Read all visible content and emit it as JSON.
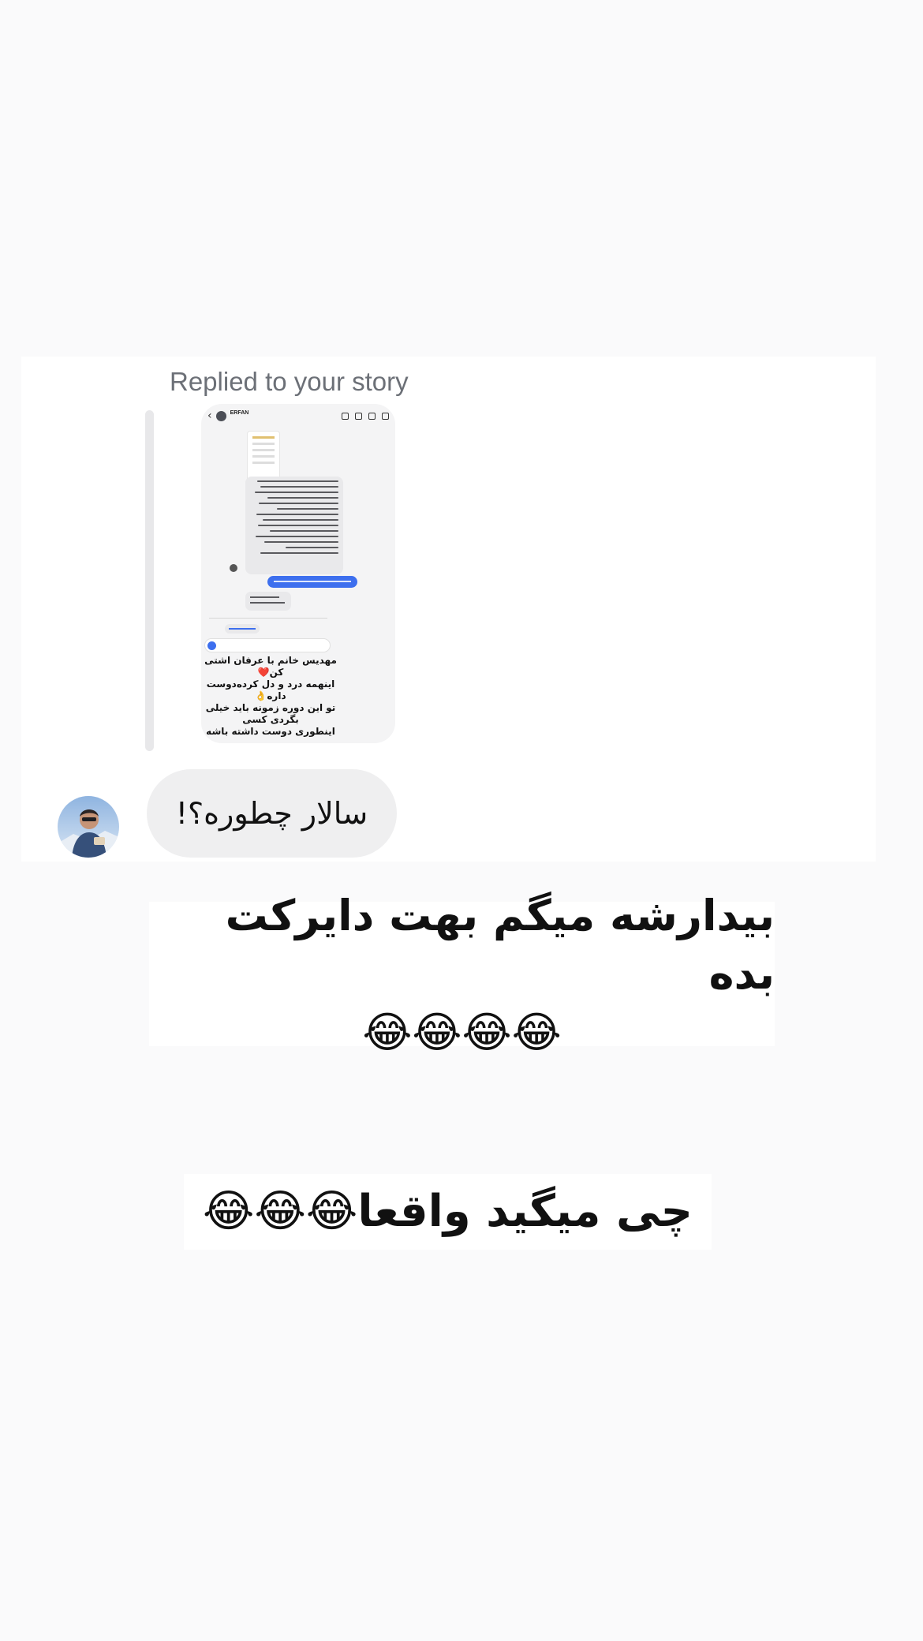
{
  "story_reply": {
    "replied_label": "Replied to your story",
    "shared_story": {
      "header_name": "ERFAN",
      "caption_lines": [
        "مهدیس خانم با عرفان اشتی کن❤️",
        "اینهمه درد و دل کرده‌دوست داره👌",
        "تو این دوره زمونه باید خیلی بگردی کسی",
        "اینطوری دوست داشته باشه"
      ]
    },
    "message": {
      "text": "سالار چطوره؟!"
    }
  },
  "story_captions": [
    {
      "lines": [
        "بیدارشه میگم بهت دایرکت بده",
        "😂😂😂😂"
      ]
    },
    {
      "lines": [
        "چی میگید واقعا😂😂😂"
      ]
    }
  ],
  "colors": {
    "background": "#fafafb",
    "bubble": "#efeff0",
    "label": "#6c7077",
    "accent_blue": "#3d6fee"
  }
}
